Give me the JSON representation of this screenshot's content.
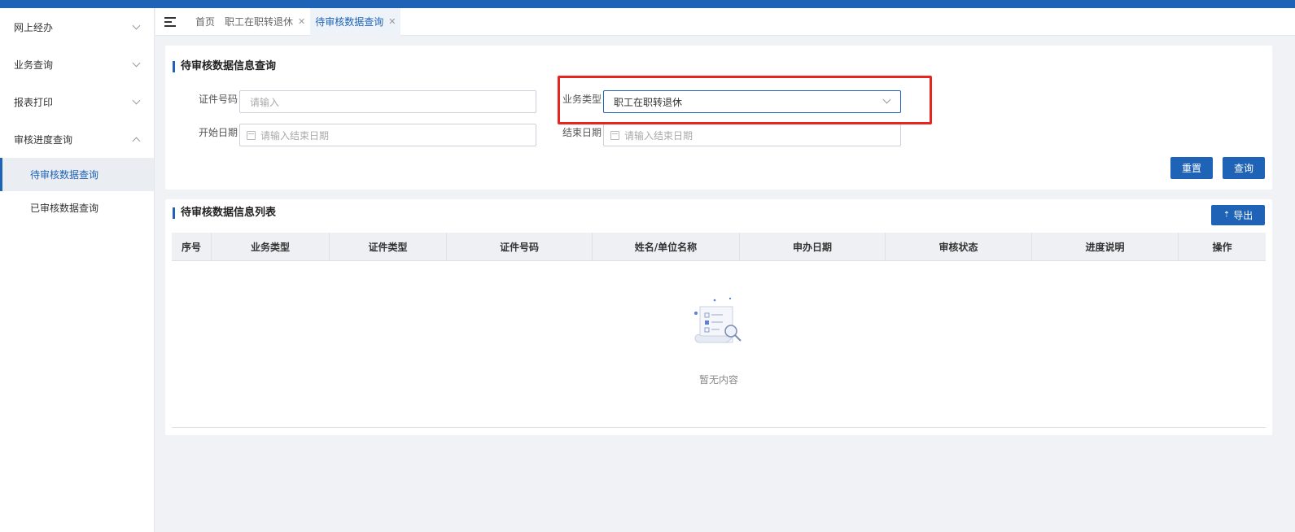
{
  "sidebar": {
    "groups": [
      {
        "label": "网上经办",
        "expanded": false
      },
      {
        "label": "业务查询",
        "expanded": false
      },
      {
        "label": "报表打印",
        "expanded": false
      },
      {
        "label": "审核进度查询",
        "expanded": true
      }
    ],
    "subitems": [
      {
        "label": "待审核数据查询",
        "active": true
      },
      {
        "label": "已审核数据查询",
        "active": false
      }
    ]
  },
  "tabs": [
    {
      "label": "首页",
      "closable": false,
      "active": false
    },
    {
      "label": "职工在职转退休",
      "closable": true,
      "active": false
    },
    {
      "label": "待审核数据查询",
      "closable": true,
      "active": true
    }
  ],
  "query_section": {
    "title": "待审核数据信息查询",
    "fields": {
      "cert_no": {
        "label": "证件号码",
        "placeholder": "请输入"
      },
      "biz_type": {
        "label": "业务类型",
        "value": "职工在职转退休"
      },
      "start_date": {
        "label": "开始日期",
        "placeholder": "请输入结束日期"
      },
      "end_date": {
        "label": "结束日期",
        "placeholder": "请输入结束日期"
      }
    },
    "reset_label": "重置",
    "query_label": "查询"
  },
  "list_section": {
    "title": "待审核数据信息列表",
    "export_label": "导出",
    "columns": [
      "序号",
      "业务类型",
      "证件类型",
      "证件号码",
      "姓名/单位名称",
      "申办日期",
      "审核状态",
      "进度说明",
      "操作"
    ],
    "rows": [],
    "empty_text": "暂无内容"
  },
  "colors": {
    "accent": "#1e63b6",
    "highlight": "#e8241f"
  }
}
